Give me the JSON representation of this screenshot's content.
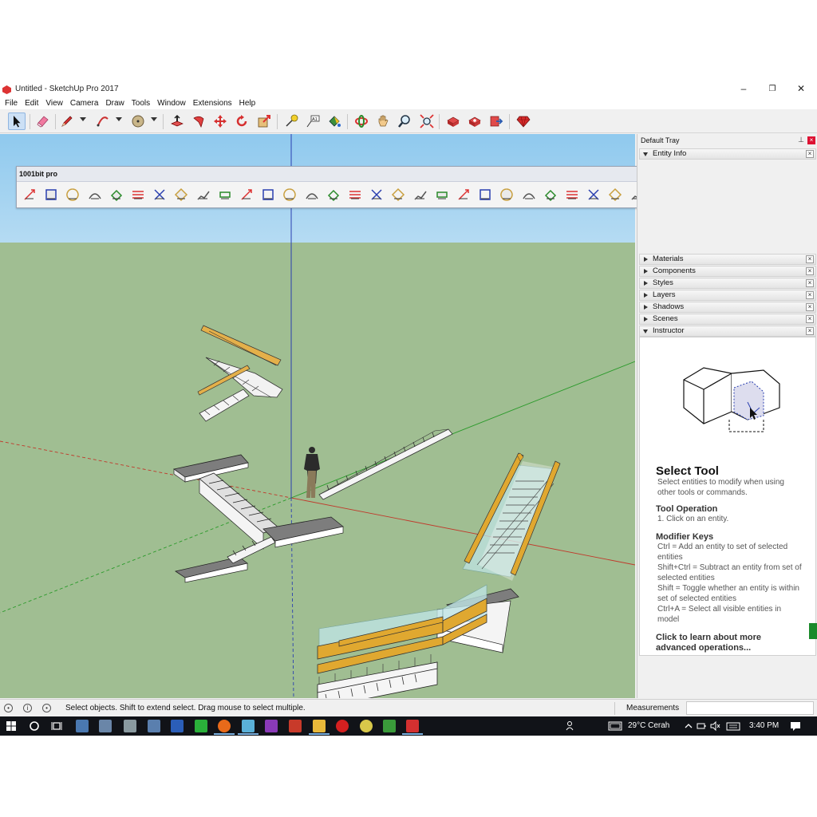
{
  "window": {
    "title": "Untitled - SketchUp Pro 2017",
    "controls": {
      "minimize": "–",
      "maximize": "❐",
      "close": "✕"
    }
  },
  "menu": [
    "File",
    "Edit",
    "View",
    "Camera",
    "Draw",
    "Tools",
    "Window",
    "Extensions",
    "Help"
  ],
  "toolbar": {
    "tools": [
      "select",
      "eraser",
      "line",
      "arc",
      "shapes",
      "push-pull",
      "follow-me",
      "move",
      "rotate",
      "scale",
      "tape-measure",
      "text",
      "paint-bucket",
      "orbit",
      "pan",
      "zoom",
      "zoom-extents",
      "3d-warehouse",
      "extension-warehouse",
      "send-to-layout",
      "extension-manager"
    ]
  },
  "floating_toolbar": {
    "title": "1001bit pro"
  },
  "tray": {
    "title": "Default Tray",
    "pin": "⊥",
    "entity_info": "Entity Info",
    "panels": [
      "Materials",
      "Components",
      "Styles",
      "Layers",
      "Shadows",
      "Scenes"
    ],
    "instructor_label": "Instructor",
    "instructor": {
      "title": "Select Tool",
      "desc": "Select entities to modify when using other tools or commands.",
      "op_heading": "Tool Operation",
      "op_text": "1. Click on an entity.",
      "mod_heading": "Modifier Keys",
      "mod_text": [
        "Ctrl = Add an entity to set of selected entities",
        "Shift+Ctrl = Subtract an entity from set of selected entities",
        "Shift = Toggle whether an entity is within set of selected entities",
        "Ctrl+A = Select all visible entities in model"
      ],
      "link": "Click to learn about more advanced operations..."
    }
  },
  "statusbar": {
    "message": "Select objects. Shift to extend select. Drag mouse to select multiple.",
    "measurements_label": "Measurements",
    "measurements_value": ""
  },
  "taskbar": {
    "weather": "29°C  Cerah",
    "time": "3:40 PM"
  },
  "colors": {
    "sky": "#8fc9ee",
    "ground": "#a0be92",
    "axis_red": "#c0392b",
    "axis_green": "#2a9a2a",
    "axis_blue": "#2a3fb0",
    "handrail": "#e0a830",
    "glass": "#bfe4e4"
  }
}
